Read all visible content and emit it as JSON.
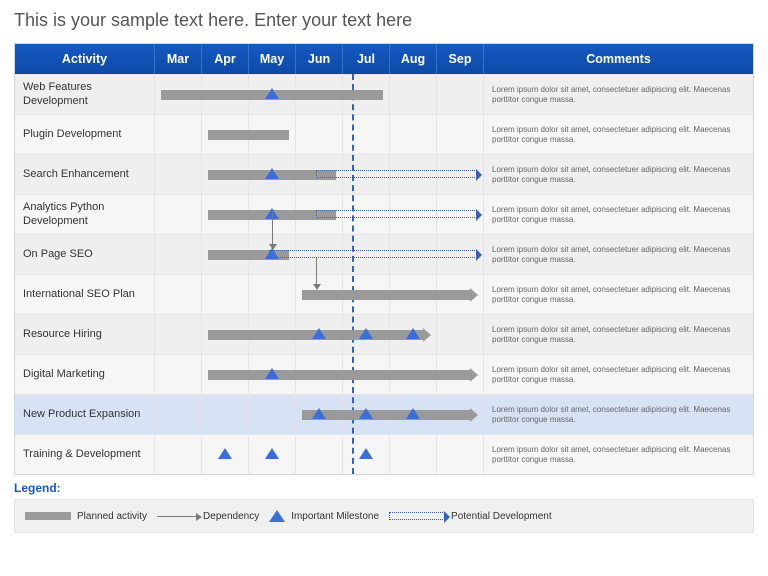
{
  "title": "This is your sample text here. Enter your text here",
  "columns": {
    "activity": "Activity",
    "comments": "Comments"
  },
  "months": [
    "Mar",
    "Apr",
    "May",
    "Jun",
    "Jul",
    "Aug",
    "Sep"
  ],
  "lorem": "Lorem ipsum dolor sit amet, consectetuer adipiscing elit. Maecenas porttitor congue massa.",
  "legend_title": "Legend:",
  "legend": {
    "planned": "Planned activity",
    "dependency": "Dependency",
    "milestone": "Important Milestone",
    "potential": "Potential Development"
  },
  "chart_data": {
    "type": "gantt",
    "timeline_months": [
      "Mar",
      "Apr",
      "May",
      "Jun",
      "Jul",
      "Aug",
      "Sep"
    ],
    "today_marker_month": "Jul",
    "activities": [
      {
        "name": "Web Features Development",
        "bars": [
          {
            "start": "Mar",
            "end": "Jul",
            "arrow": false
          }
        ],
        "milestones": [
          "May"
        ],
        "highlight": false
      },
      {
        "name": "Plugin Development",
        "bars": [
          {
            "start": "Apr",
            "end": "May",
            "arrow": false
          }
        ],
        "milestones": [],
        "highlight": false
      },
      {
        "name": "Search Enhancement",
        "bars": [
          {
            "start": "Apr",
            "end": "Jun",
            "arrow": false
          }
        ],
        "milestones": [
          "May"
        ],
        "potential": {
          "start": "Jun",
          "end": "Sep"
        },
        "highlight": false
      },
      {
        "name": "Analytics Python Development",
        "bars": [
          {
            "start": "Apr",
            "end": "Jun",
            "arrow": false
          }
        ],
        "milestones": [
          "May"
        ],
        "potential": {
          "start": "Jun",
          "end": "Sep"
        },
        "highlight": false
      },
      {
        "name": "On Page SEO",
        "bars": [
          {
            "start": "Apr",
            "end": "May",
            "arrow": false
          }
        ],
        "milestones": [
          "May"
        ],
        "potential": {
          "start": "May",
          "end": "Sep"
        },
        "dependency_from_row": 3,
        "highlight": false
      },
      {
        "name": "International SEO Plan",
        "bars": [
          {
            "start": "Jun",
            "end": "Sep",
            "arrow": true
          }
        ],
        "milestones": [],
        "dependency_vertical_at": "Jun",
        "highlight": false
      },
      {
        "name": "Resource Hiring",
        "bars": [
          {
            "start": "Apr",
            "end": "Aug",
            "arrow": true
          }
        ],
        "milestones": [
          "Jun",
          "Jul",
          "Aug"
        ],
        "highlight": false
      },
      {
        "name": "Digital Marketing",
        "bars": [
          {
            "start": "Apr",
            "end": "Sep",
            "arrow": true
          }
        ],
        "milestones": [
          "May"
        ],
        "highlight": false
      },
      {
        "name": "New Product  Expansion",
        "bars": [
          {
            "start": "Jun",
            "end": "Sep",
            "arrow": true
          }
        ],
        "milestones": [
          "Jun",
          "Jul",
          "Aug"
        ],
        "highlight": true
      },
      {
        "name": "Training & Development",
        "bars": [],
        "milestones": [
          "Apr",
          "May",
          "Jul"
        ],
        "highlight": false
      }
    ]
  }
}
